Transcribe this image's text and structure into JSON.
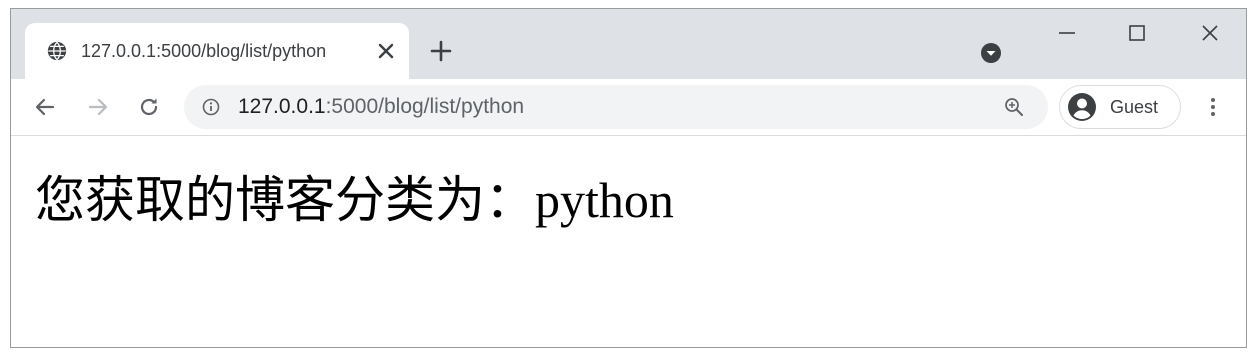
{
  "browser": {
    "tab": {
      "title": "127.0.0.1:5000/blog/list/python",
      "favicon": "globe-icon",
      "close_icon": "close-icon"
    },
    "new_tab_icon": "plus-icon",
    "tab_search_icon": "chevron-down-circle-icon",
    "window_controls": [
      "minimize-icon",
      "maximize-icon",
      "close-icon"
    ],
    "toolbar": {
      "back_icon": "arrow-left-icon",
      "forward_icon": "arrow-right-icon",
      "reload_icon": "reload-icon",
      "address": {
        "info_icon": "info-icon",
        "host": "127.0.0.1",
        "path": ":5000/blog/list/python",
        "zoom_icon": "zoom-icon"
      },
      "profile": {
        "avatar_icon": "account-circle-icon",
        "label": "Guest"
      },
      "menu_icon": "three-dots-vertical-icon"
    }
  },
  "page": {
    "heading": "您获取的博客分类为：python"
  },
  "colors": {
    "tabstrip_bg": "#dee1e6",
    "omnibox_bg": "#f1f3f4",
    "icon": "#5f6368",
    "text_dark": "#202124"
  }
}
